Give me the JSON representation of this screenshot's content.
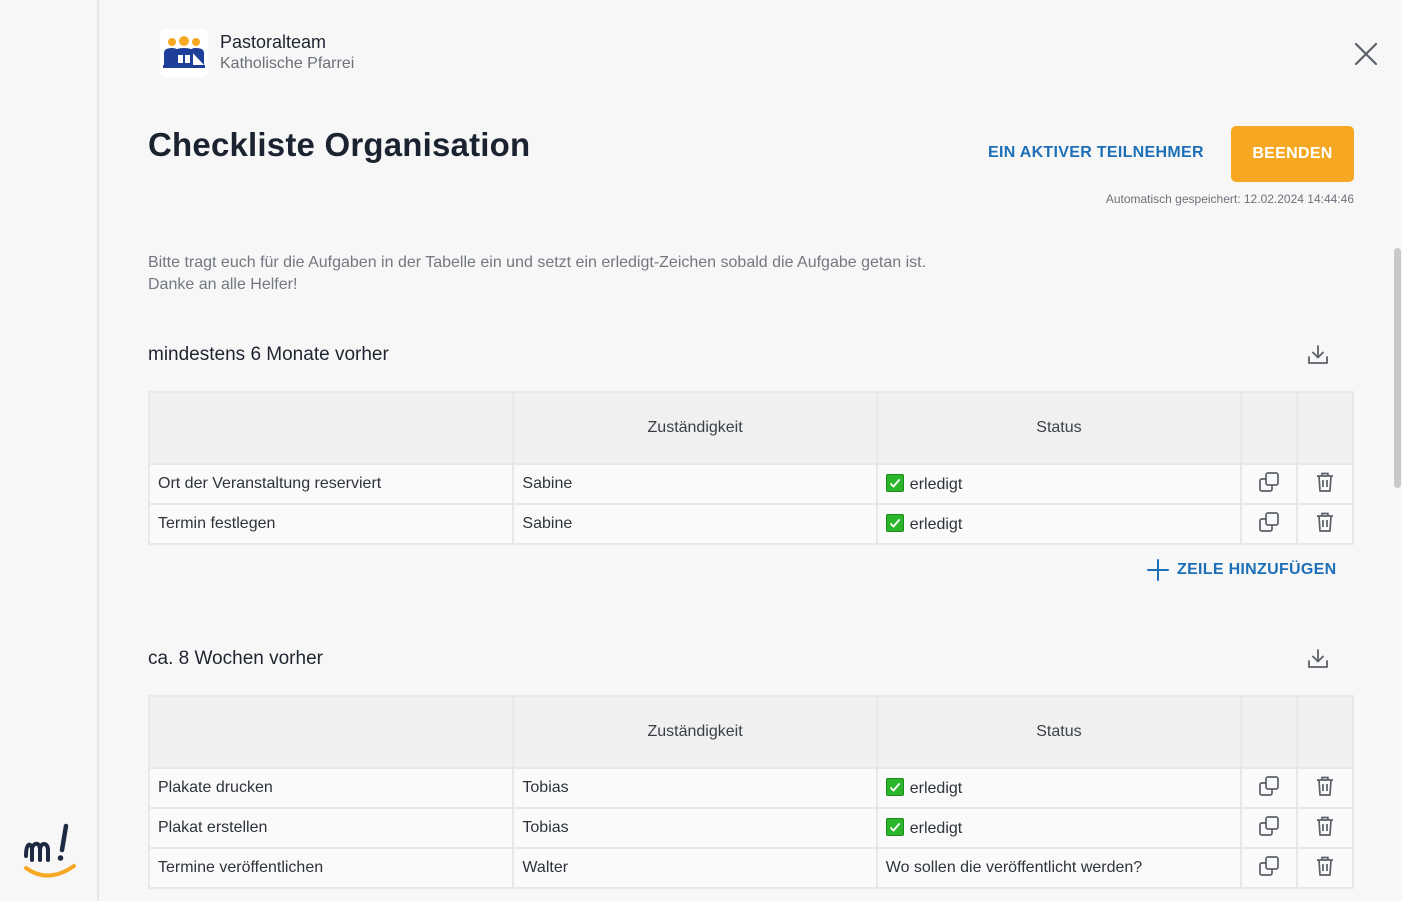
{
  "team": {
    "name": "Pastoralteam",
    "subtitle": "Katholische Pfarrei"
  },
  "page": {
    "title": "Checkliste Organisation",
    "participants_label": "EIN AKTIVER TEILNEHMER",
    "finish_label": "BEENDEN",
    "autosave": "Automatisch gespeichert: 12.02.2024 14:44:46",
    "description_line1": "Bitte tragt euch für die Aufgaben in der Tabelle ein und setzt ein erledigt-Zeichen sobald die Aufgabe getan ist.",
    "description_line2": "Danke an alle Helfer!"
  },
  "sections": [
    {
      "title": "mindestens 6 Monate vorher",
      "columns": [
        "",
        "Zuständigkeit",
        "Status",
        "",
        ""
      ],
      "rows": [
        {
          "task": "Ort der Veranstaltung reserviert",
          "responsible": "Sabine",
          "status": "erledigt",
          "done": true
        },
        {
          "task": "Termin festlegen",
          "responsible": "Sabine",
          "status": "erledigt",
          "done": true
        }
      ],
      "add_row_label": "ZEILE HINZUFÜGEN"
    },
    {
      "title": "ca. 8 Wochen vorher",
      "columns": [
        "",
        "Zuständigkeit",
        "Status",
        "",
        ""
      ],
      "rows": [
        {
          "task": "Plakate drucken",
          "responsible": "Tobias",
          "status": "erledigt",
          "done": true
        },
        {
          "task": "Plakat erstellen",
          "responsible": "Tobias",
          "status": "erledigt",
          "done": true
        },
        {
          "task": "Termine veröffentlichen",
          "responsible": "Walter",
          "status": "Wo sollen die veröffentlicht werden?",
          "done": false
        }
      ]
    }
  ],
  "icons": {
    "close": "close-icon",
    "download": "download-icon",
    "copy": "copy-icon",
    "delete": "trash-icon",
    "add": "plus-icon",
    "check": "checkbox-checked-icon"
  },
  "colors": {
    "accent_orange": "#f7a823",
    "link_blue": "#1d6fb8",
    "check_green": "#2bb52b",
    "title_dark": "#1b2331"
  }
}
